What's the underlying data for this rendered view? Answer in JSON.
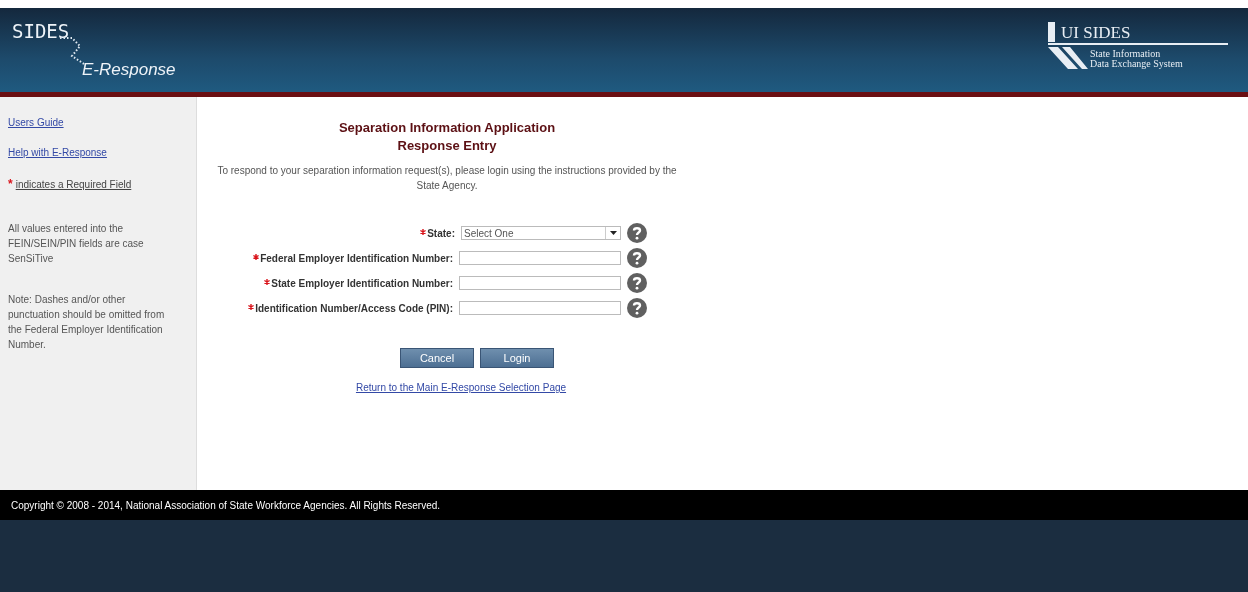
{
  "header": {
    "logo": {
      "main": "SIDES",
      "sub": "E-Response"
    },
    "partner_logo": {
      "title": "UI SIDES",
      "subtitle_1": "State Information",
      "subtitle_2": "Data Exchange System"
    }
  },
  "sidebar": {
    "links": [
      "Users Guide",
      "Help with E-Response"
    ],
    "required_note": {
      "mark": "*",
      "text": "indicates a Required Field"
    },
    "notes": [
      "All values entered into the FEIN/SEIN/PIN fields are case SenSiTive",
      "Note: Dashes and/or other punctuation should be omitted from the Federal Employer Identification Number."
    ]
  },
  "main": {
    "title": "Separation Information Application",
    "subtitle": "Response Entry",
    "intro": "To respond to your separation information request(s), please login using the instructions provided by the State Agency.",
    "fields": [
      {
        "kind": "select",
        "required": true,
        "label": "State:",
        "value": "Select One"
      },
      {
        "kind": "text",
        "required": true,
        "label": "Federal Employer Identification Number:"
      },
      {
        "kind": "text",
        "required": true,
        "label": "State Employer Identification Number:"
      },
      {
        "kind": "text",
        "required": true,
        "label": "Identification Number/Access Code (PIN):"
      }
    ],
    "buttons": [
      "Cancel",
      "Login"
    ],
    "return_link": "Return to the Main E-Response Selection Page"
  },
  "footer": {
    "copyright": "Copyright © 2008 - 2014, National Association of State Workforce Agencies. All Rights Reserved."
  }
}
